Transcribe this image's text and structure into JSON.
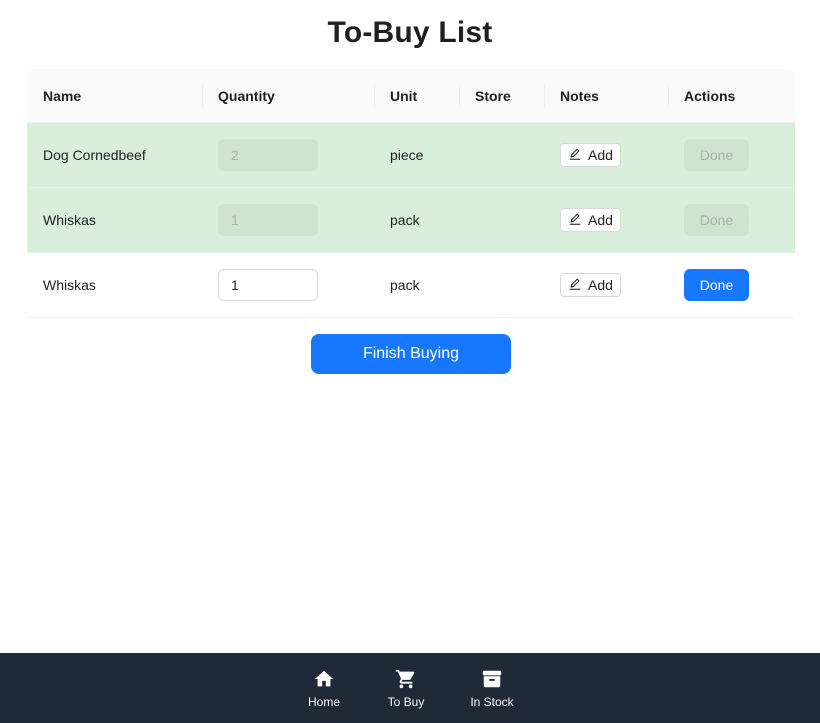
{
  "title": "To-Buy List",
  "table": {
    "headers": {
      "name": "Name",
      "quantity": "Quantity",
      "unit": "Unit",
      "store": "Store",
      "notes": "Notes",
      "actions": "Actions"
    },
    "rows": [
      {
        "name": "Dog Cornedbeef",
        "quantity": "2",
        "unit": "piece",
        "store": "",
        "notes_label": "Add",
        "action_label": "Done",
        "completed": true
      },
      {
        "name": "Whiskas",
        "quantity": "1",
        "unit": "pack",
        "store": "",
        "notes_label": "Add",
        "action_label": "Done",
        "completed": true
      },
      {
        "name": "Whiskas",
        "quantity": "1",
        "unit": "pack",
        "store": "",
        "notes_label": "Add",
        "action_label": "Done",
        "completed": false
      }
    ]
  },
  "finish_button": "Finish Buying",
  "nav": {
    "items": [
      {
        "label": "Home",
        "icon": "home-icon"
      },
      {
        "label": "To Buy",
        "icon": "cart-icon"
      },
      {
        "label": "In Stock",
        "icon": "archive-icon"
      }
    ]
  },
  "colors": {
    "primary": "#1677ff",
    "completed_row": "#d9eedb",
    "nav_background": "#1f2937"
  }
}
